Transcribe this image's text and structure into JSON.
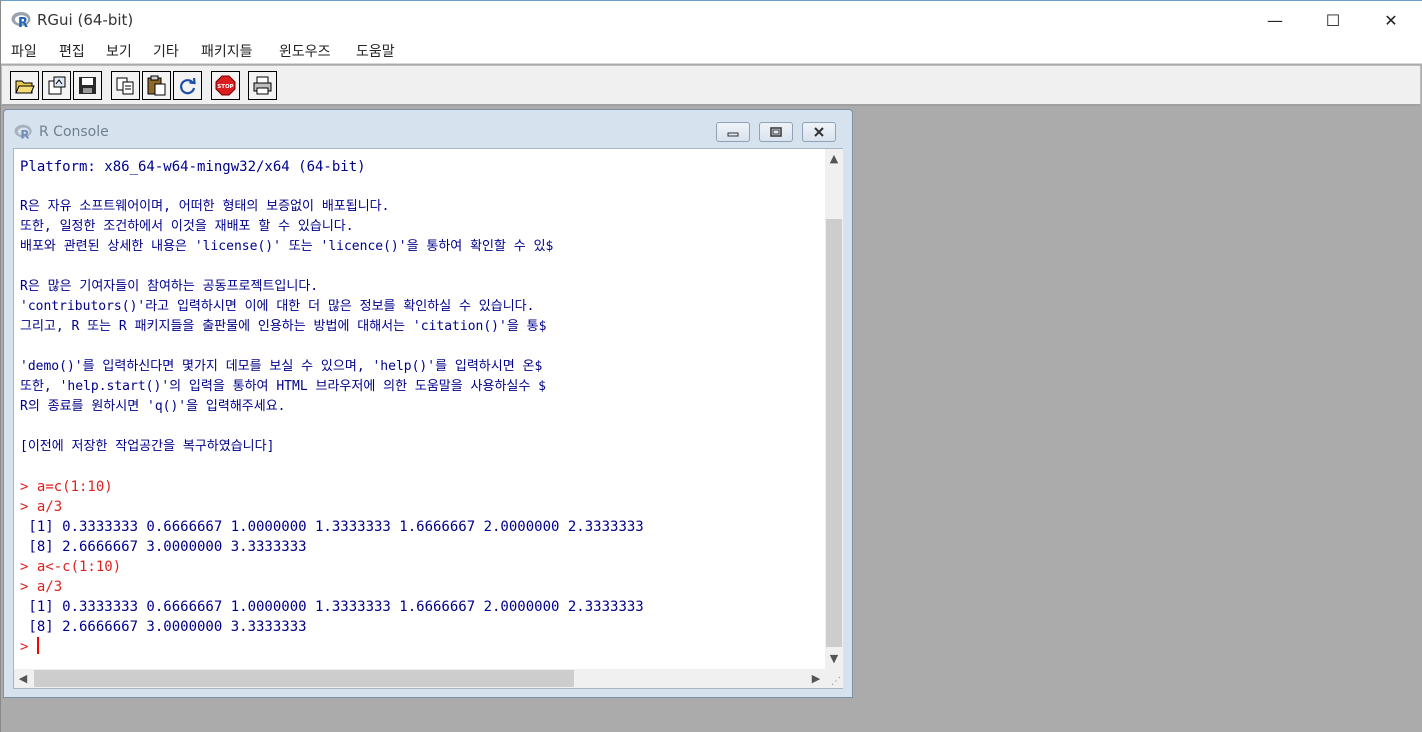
{
  "window": {
    "title": "RGui (64-bit)",
    "minimize_glyph": "—",
    "maximize_glyph": "☐",
    "close_glyph": "✕"
  },
  "menu": [
    "파일",
    "편집",
    "보기",
    "기타",
    "패키지들",
    "윈도우즈",
    "도움말"
  ],
  "toolbar": {
    "buttons": [
      "open-script-icon",
      "load-workspace-icon",
      "save-icon",
      "copy-icon",
      "paste-icon",
      "refresh-icon",
      "stop-icon",
      "print-icon"
    ],
    "stop_label": "STOP"
  },
  "console": {
    "title": "R Console",
    "lines": [
      {
        "text": "Platform: x86_64-w64-mingw32/x64 (64-bit)",
        "kind": "out"
      },
      {
        "text": "",
        "kind": "blank"
      },
      {
        "text": "R은 자유 소프트웨어이며, 어떠한 형태의 보증없이 배포됩니다.",
        "kind": "small"
      },
      {
        "text": "또한, 일정한 조건하에서 이것을 재배포 할 수 있습니다.",
        "kind": "small"
      },
      {
        "text": "배포와 관련된 상세한 내용은 'license()' 또는 'licence()'을 통하여 확인할 수 있$",
        "kind": "small"
      },
      {
        "text": "",
        "kind": "blank"
      },
      {
        "text": "R은 많은 기여자들이 참여하는 공동프로젝트입니다.",
        "kind": "small"
      },
      {
        "text": "'contributors()'라고 입력하시면 이에 대한 더 많은 정보를 확인하실 수 있습니다.",
        "kind": "small"
      },
      {
        "text": "그리고, R 또는 R 패키지들을 출판물에 인용하는 방법에 대해서는 'citation()'을 통$",
        "kind": "small"
      },
      {
        "text": "",
        "kind": "blank"
      },
      {
        "text": "'demo()'를 입력하신다면 몇가지 데모를 보실 수 있으며, 'help()'를 입력하시면 온$",
        "kind": "small"
      },
      {
        "text": "또한, 'help.start()'의 입력을 통하여 HTML 브라우저에 의한 도움말을 사용하실수 $",
        "kind": "small"
      },
      {
        "text": "R의 종료를 원하시면 'q()'을 입력해주세요.",
        "kind": "small"
      },
      {
        "text": "",
        "kind": "blank"
      },
      {
        "text": "[이전에 저장한 작업공간을 복구하였습니다]",
        "kind": "small"
      },
      {
        "text": "",
        "kind": "blank"
      },
      {
        "text": "> a=c(1:10)",
        "kind": "cmd"
      },
      {
        "text": "> a/3",
        "kind": "cmd"
      },
      {
        "text": " [1] 0.3333333 0.6666667 1.0000000 1.3333333 1.6666667 2.0000000 2.3333333",
        "kind": "out"
      },
      {
        "text": " [8] 2.6666667 3.0000000 3.3333333",
        "kind": "out"
      },
      {
        "text": "> a<-c(1:10)",
        "kind": "cmd"
      },
      {
        "text": "> a/3",
        "kind": "cmd"
      },
      {
        "text": " [1] 0.3333333 0.6666667 1.0000000 1.3333333 1.6666667 2.0000000 2.3333333",
        "kind": "out"
      },
      {
        "text": " [8] 2.6666667 3.0000000 3.3333333",
        "kind": "out"
      }
    ],
    "prompt": "> "
  },
  "colors": {
    "command": "#e0201d",
    "output": "#00008b",
    "workspace_bg": "#ababab"
  }
}
